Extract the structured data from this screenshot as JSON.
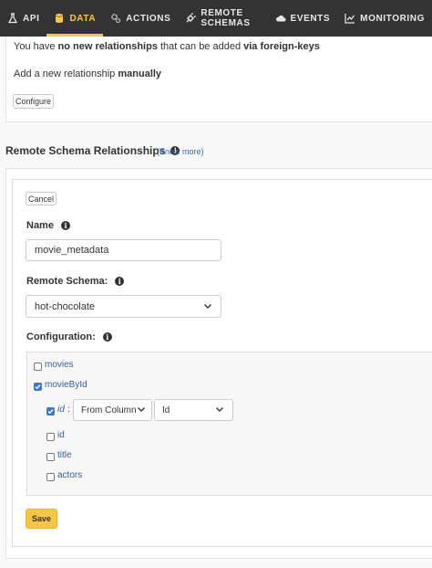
{
  "nav": {
    "items": [
      {
        "label": "API",
        "icon": "flask-icon"
      },
      {
        "label": "DATA",
        "icon": "database-icon",
        "active": true
      },
      {
        "label": "ACTIONS",
        "icon": "gears-icon"
      },
      {
        "label": "REMOTE SCHEMAS",
        "icon": "plug-icon"
      },
      {
        "label": "EVENTS",
        "icon": "cloud-icon"
      },
      {
        "label": "MONITORING",
        "icon": "chart-icon"
      }
    ]
  },
  "fk": {
    "text_pre": "You have ",
    "text_bold1": "no new relationships",
    "text_mid": " that can be added ",
    "text_bold2": "via foreign-keys",
    "manual_pre": "Add a new relationship ",
    "manual_bold": "manually",
    "configure_label": "Configure"
  },
  "remote": {
    "title": "Remote Schema Relationships",
    "know_more": "(Know more)",
    "cancel_label": "Cancel",
    "name_label": "Name",
    "name_value": "movie_metadata",
    "schema_label": "Remote Schema:",
    "schema_value": "hot-chocolate",
    "config_label": "Configuration:",
    "fields": {
      "movies": "movies",
      "movieById": "movieById",
      "arg_id": "id",
      "arg_colon": ":",
      "from_select": "From Column",
      "column_select": "Id",
      "sub_id": "id",
      "sub_title": "title",
      "sub_actors": "actors"
    },
    "save_label": "Save"
  },
  "colors": {
    "accent": "#f9c548",
    "nav_bg": "#333333",
    "link": "#3a5f8f"
  }
}
